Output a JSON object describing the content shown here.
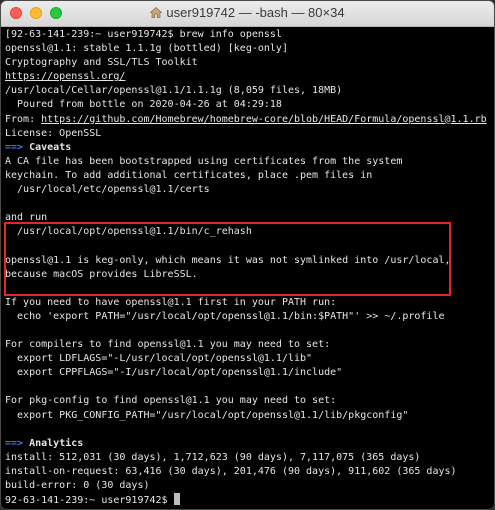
{
  "window": {
    "title": "user919742 — -bash — 80×34"
  },
  "terminal": {
    "lines": [
      "[92-63-141-239:~ user919742$ brew info openssl",
      "openssl@1.1: stable 1.1.1g (bottled) [keg-only]",
      "Cryptography and SSL/TLS Toolkit",
      "https://openssl.org/",
      "/usr/local/Cellar/openssl@1.1/1.1.1g (8,059 files, 18MB)",
      "  Poured from bottle on 2020-04-26 at 04:29:18",
      "From: https://github.com/Homebrew/homebrew-core/blob/HEAD/Formula/openssl@1.1.rb",
      "License: OpenSSL",
      "==> Caveats",
      "A CA file has been bootstrapped using certificates from the system",
      "keychain. To add additional certificates, place .pem files in",
      "  /usr/local/etc/openssl@1.1/certs",
      "",
      "and run",
      "  /usr/local/opt/openssl@1.1/bin/c_rehash",
      "",
      "openssl@1.1 is keg-only, which means it was not symlinked into /usr/local,",
      "because macOS provides LibreSSL.",
      "",
      "If you need to have openssl@1.1 first in your PATH run:",
      "  echo 'export PATH=\"/usr/local/opt/openssl@1.1/bin:$PATH\"' >> ~/.profile",
      "",
      "For compilers to find openssl@1.1 you may need to set:",
      "  export LDFLAGS=\"-L/usr/local/opt/openssl@1.1/lib\"",
      "  export CPPFLAGS=\"-I/usr/local/opt/openssl@1.1/include\"",
      "",
      "For pkg-config to find openssl@1.1 you may need to set:",
      "  export PKG_CONFIG_PATH=\"/usr/local/opt/openssl@1.1/lib/pkgconfig\"",
      "",
      "==> Analytics",
      "install: 512,031 (30 days), 1,712,623 (90 days), 7,117,075 (365 days)",
      "install-on-request: 63,416 (30 days), 201,476 (90 days), 911,602 (365 days)",
      "build-error: 0 (30 days)",
      "92-63-141-239:~ user919742$ "
    ],
    "link_lines": [
      3,
      6
    ],
    "heading_lines": [
      8,
      29
    ],
    "highlight_color": "#e5252a"
  }
}
